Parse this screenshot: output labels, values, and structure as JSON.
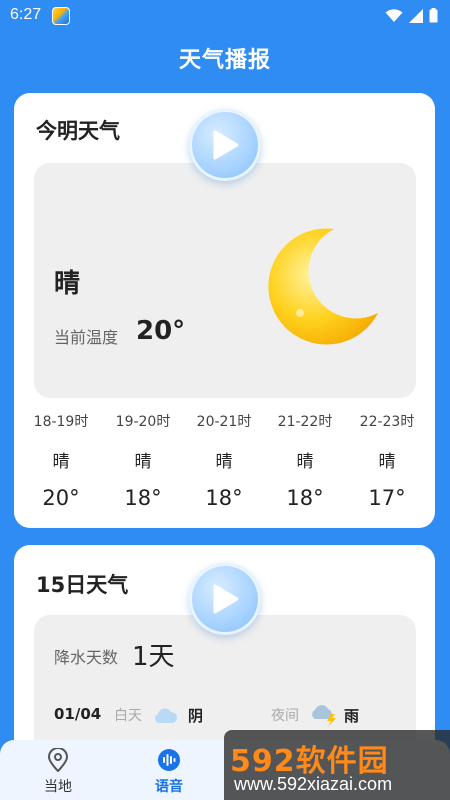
{
  "status": {
    "time": "6:27"
  },
  "app": {
    "title": "天气播报"
  },
  "today": {
    "title": "今明天气",
    "condition": "晴",
    "temp_label": "当前温度",
    "temp_value": "20°",
    "hourly": [
      {
        "hour": "18-19时",
        "cond": "晴",
        "temp": "20°"
      },
      {
        "hour": "19-20时",
        "cond": "晴",
        "temp": "18°"
      },
      {
        "hour": "20-21时",
        "cond": "晴",
        "temp": "18°"
      },
      {
        "hour": "21-22时",
        "cond": "晴",
        "temp": "18°"
      },
      {
        "hour": "22-23时",
        "cond": "晴",
        "temp": "17°"
      }
    ]
  },
  "forecast": {
    "title": "15日天气",
    "rain_label": "降水天数",
    "rain_value": "1天",
    "row": {
      "date": "01/04",
      "day_label": "白天",
      "day_cond": "阴",
      "night_label": "夜间",
      "night_cond": "雨"
    }
  },
  "tabs": {
    "local": "当地",
    "voice": "语音"
  },
  "watermark": {
    "title": "592软件园",
    "url": "www.592xiazai.com"
  },
  "colors": {
    "background": "#2f8cf2",
    "active_tab": "#1a73e8"
  }
}
